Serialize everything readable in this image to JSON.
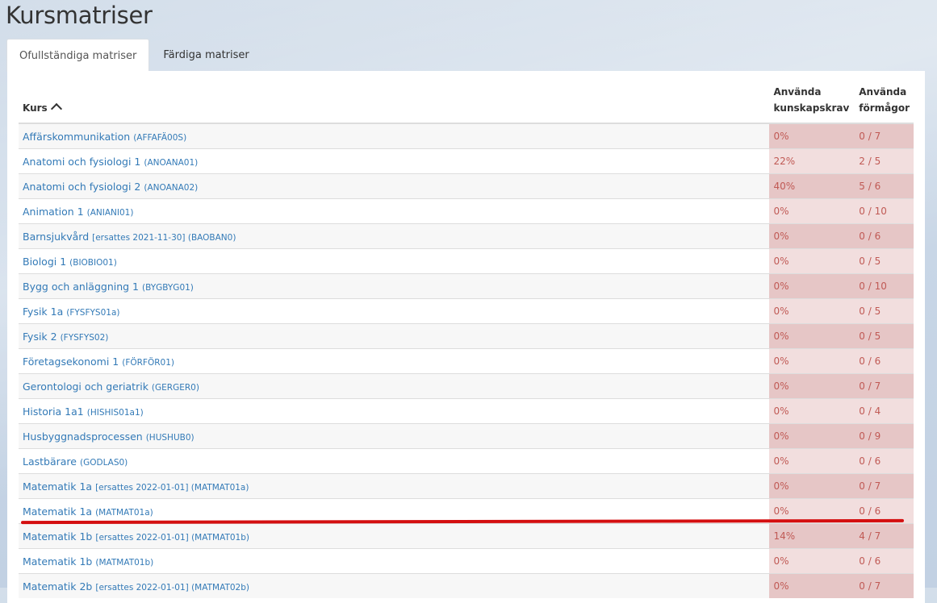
{
  "page": {
    "title": "Kursmatriser"
  },
  "tabs": [
    {
      "label": "Ofullständiga matriser",
      "active": true
    },
    {
      "label": "Färdiga matriser",
      "active": false
    }
  ],
  "table": {
    "headers": {
      "course": "Kurs",
      "used_requirements": "Använda kunskapskrav",
      "used_abilities": "Använda förmågor"
    },
    "rows": [
      {
        "name": "Affärskommunikation",
        "code": "(AFFAFÄ00S)",
        "pct": "0%",
        "abilities": "0 / 7"
      },
      {
        "name": "Anatomi och fysiologi 1",
        "code": "(ANOANA01)",
        "pct": "22%",
        "abilities": "2 / 5"
      },
      {
        "name": "Anatomi och fysiologi 2",
        "code": "(ANOANA02)",
        "pct": "40%",
        "abilities": "5 / 6"
      },
      {
        "name": "Animation 1",
        "code": "(ANIANI01)",
        "pct": "0%",
        "abilities": "0 / 10"
      },
      {
        "name": "Barnsjukvård",
        "code": "[ersattes 2021-11-30] (BAOBAN0)",
        "pct": "0%",
        "abilities": "0 / 6"
      },
      {
        "name": "Biologi 1",
        "code": "(BIOBIO01)",
        "pct": "0%",
        "abilities": "0 / 5"
      },
      {
        "name": "Bygg och anläggning 1",
        "code": "(BYGBYG01)",
        "pct": "0%",
        "abilities": "0 / 10"
      },
      {
        "name": "Fysik 1a",
        "code": "(FYSFYS01a)",
        "pct": "0%",
        "abilities": "0 / 5"
      },
      {
        "name": "Fysik 2",
        "code": "(FYSFYS02)",
        "pct": "0%",
        "abilities": "0 / 5"
      },
      {
        "name": "Företagsekonomi 1",
        "code": "(FÖRFÖR01)",
        "pct": "0%",
        "abilities": "0 / 6"
      },
      {
        "name": "Gerontologi och geriatrik",
        "code": "(GERGER0)",
        "pct": "0%",
        "abilities": "0 / 7"
      },
      {
        "name": "Historia 1a1",
        "code": "(HISHIS01a1)",
        "pct": "0%",
        "abilities": "0 / 4"
      },
      {
        "name": "Husbyggnadsprocessen",
        "code": "(HUSHUB0)",
        "pct": "0%",
        "abilities": "0 / 9"
      },
      {
        "name": "Lastbärare",
        "code": "(GODLAS0)",
        "pct": "0%",
        "abilities": "0 / 6"
      },
      {
        "name": "Matematik 1a",
        "code": "[ersattes 2022-01-01] (MATMAT01a)",
        "pct": "0%",
        "abilities": "0 / 7"
      },
      {
        "name": "Matematik 1a",
        "code": "(MATMAT01a)",
        "pct": "0%",
        "abilities": "0 / 6"
      },
      {
        "name": "Matematik 1b",
        "code": "[ersattes 2022-01-01] (MATMAT01b)",
        "pct": "14%",
        "abilities": "4 / 7"
      },
      {
        "name": "Matematik 1b",
        "code": "(MATMAT01b)",
        "pct": "0%",
        "abilities": "0 / 6"
      },
      {
        "name": "Matematik 2b",
        "code": "[ersattes 2022-01-01] (MATMAT02b)",
        "pct": "0%",
        "abilities": "0 / 7"
      }
    ]
  },
  "colors": {
    "link": "#337ab7",
    "stat_bg": "#f2dede",
    "stat_text": "#c05a55",
    "annotation_line": "#d40f10"
  }
}
